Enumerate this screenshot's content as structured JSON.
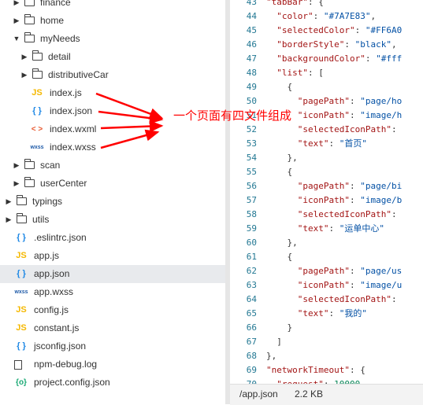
{
  "tree": [
    {
      "type": "folder",
      "label": "finance",
      "expanded": false
    },
    {
      "type": "folder",
      "label": "home",
      "expanded": false
    },
    {
      "type": "folder",
      "label": "myNeeds",
      "expanded": true
    },
    {
      "type": "folder",
      "label": "detail",
      "expanded": false
    },
    {
      "type": "folder",
      "label": "distributiveCar",
      "expanded": false
    },
    {
      "type": "file",
      "icon": "JS",
      "kind": "js",
      "label": "index.js"
    },
    {
      "type": "file",
      "icon": "{ }",
      "kind": "json",
      "label": "index.json"
    },
    {
      "type": "file",
      "icon": "< >",
      "kind": "wxml",
      "label": "index.wxml"
    },
    {
      "type": "file",
      "icon": "wxss",
      "kind": "wxss",
      "label": "index.wxss"
    },
    {
      "type": "folder",
      "label": "scan",
      "expanded": false
    },
    {
      "type": "folder",
      "label": "userCenter",
      "expanded": false
    },
    {
      "type": "folder",
      "label": "typings",
      "expanded": false
    },
    {
      "type": "folder",
      "label": "utils",
      "expanded": false
    },
    {
      "type": "file",
      "icon": "{ }",
      "kind": "json",
      "label": ".eslintrc.json"
    },
    {
      "type": "file",
      "icon": "JS",
      "kind": "js",
      "label": "app.js"
    },
    {
      "type": "file",
      "icon": "{ }",
      "kind": "json",
      "label": "app.json"
    },
    {
      "type": "file",
      "icon": "wxss",
      "kind": "wxss",
      "label": "app.wxss"
    },
    {
      "type": "file",
      "icon": "JS",
      "kind": "js",
      "label": "config.js"
    },
    {
      "type": "file",
      "icon": "JS",
      "kind": "js",
      "label": "constant.js"
    },
    {
      "type": "file",
      "icon": "{ }",
      "kind": "json",
      "label": "jsconfig.json"
    },
    {
      "type": "file",
      "icon": "",
      "kind": "log",
      "label": "npm-debug.log"
    },
    {
      "type": "file",
      "icon": "{o}",
      "kind": "proj",
      "label": "project.config.json"
    }
  ],
  "annotation": "一个页面有四文件组成",
  "code": [
    {
      "num": "43",
      "text": "\"tabBar\": {"
    },
    {
      "num": "44",
      "text": "  \"color\": \"#7A7E83\","
    },
    {
      "num": "45",
      "text": "  \"selectedColor\": \"#FF6A0"
    },
    {
      "num": "46",
      "text": "  \"borderStyle\": \"black\","
    },
    {
      "num": "47",
      "text": "  \"backgroundColor\": \"#fff"
    },
    {
      "num": "48",
      "text": "  \"list\": ["
    },
    {
      "num": "49",
      "text": "    {"
    },
    {
      "num": "50",
      "text": "      \"pagePath\": \"page/ho"
    },
    {
      "num": "51",
      "text": "      \"iconPath\": \"image/h"
    },
    {
      "num": "52",
      "text": "      \"selectedIconPath\":"
    },
    {
      "num": "53",
      "text": "      \"text\": \"首页\""
    },
    {
      "num": "54",
      "text": "    },"
    },
    {
      "num": "55",
      "text": "    {"
    },
    {
      "num": "56",
      "text": "      \"pagePath\": \"page/bi"
    },
    {
      "num": "57",
      "text": "      \"iconPath\": \"image/b"
    },
    {
      "num": "58",
      "text": "      \"selectedIconPath\":"
    },
    {
      "num": "59",
      "text": "      \"text\": \"运单中心\""
    },
    {
      "num": "60",
      "text": "    },"
    },
    {
      "num": "61",
      "text": "    {"
    },
    {
      "num": "62",
      "text": "      \"pagePath\": \"page/us"
    },
    {
      "num": "63",
      "text": "      \"iconPath\": \"image/u"
    },
    {
      "num": "64",
      "text": "      \"selectedIconPath\":"
    },
    {
      "num": "65",
      "text": "      \"text\": \"我的\""
    },
    {
      "num": "66",
      "text": "    }"
    },
    {
      "num": "67",
      "text": "  ]"
    },
    {
      "num": "68",
      "text": "},"
    },
    {
      "num": "69",
      "text": "\"networkTimeout\": {"
    },
    {
      "num": "70",
      "text": "  \"request\": 10000,"
    }
  ],
  "status": {
    "file": "/app.json",
    "size": "2.2 KB"
  },
  "colors": {
    "annotation": "#ff0000",
    "selected_row": "#e8eaed",
    "line_number": "#237893"
  }
}
